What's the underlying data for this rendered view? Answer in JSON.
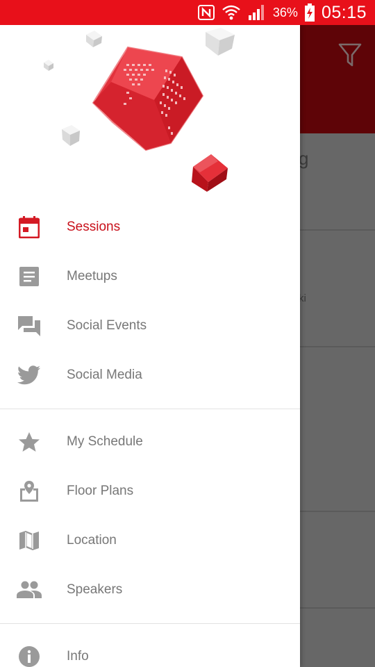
{
  "status_bar": {
    "battery": "36%",
    "time": "05:15",
    "icons": [
      "nfc-icon",
      "wifi-icon",
      "signal-icon",
      "battery-charging-icon"
    ]
  },
  "background_app": {
    "toolbar_icon": "filter-icon",
    "peek_texts": [
      "g",
      "ki"
    ]
  },
  "drawer": {
    "header_graphic": "red-world-map-cube-logo",
    "sections": [
      {
        "items": [
          {
            "label": "Sessions",
            "icon": "calendar-icon",
            "active": true
          },
          {
            "label": "Meetups",
            "icon": "document-icon",
            "active": false
          },
          {
            "label": "Social Events",
            "icon": "chat-bubbles-icon",
            "active": false
          },
          {
            "label": "Social Media",
            "icon": "twitter-icon",
            "active": false
          }
        ]
      },
      {
        "items": [
          {
            "label": "My Schedule",
            "icon": "star-icon",
            "active": false
          },
          {
            "label": "Floor Plans",
            "icon": "map-pin-icon",
            "active": false
          },
          {
            "label": "Location",
            "icon": "map-icon",
            "active": false
          },
          {
            "label": "Speakers",
            "icon": "people-icon",
            "active": false
          }
        ]
      },
      {
        "items": [
          {
            "label": "Info",
            "icon": "info-icon",
            "active": false
          }
        ]
      }
    ]
  },
  "colors": {
    "accent": "#e8101a",
    "active_item": "#c8101a",
    "inactive_text": "#777777",
    "inactive_icon": "#9a9a9a",
    "toolbar_dimmed": "#5e0407"
  }
}
